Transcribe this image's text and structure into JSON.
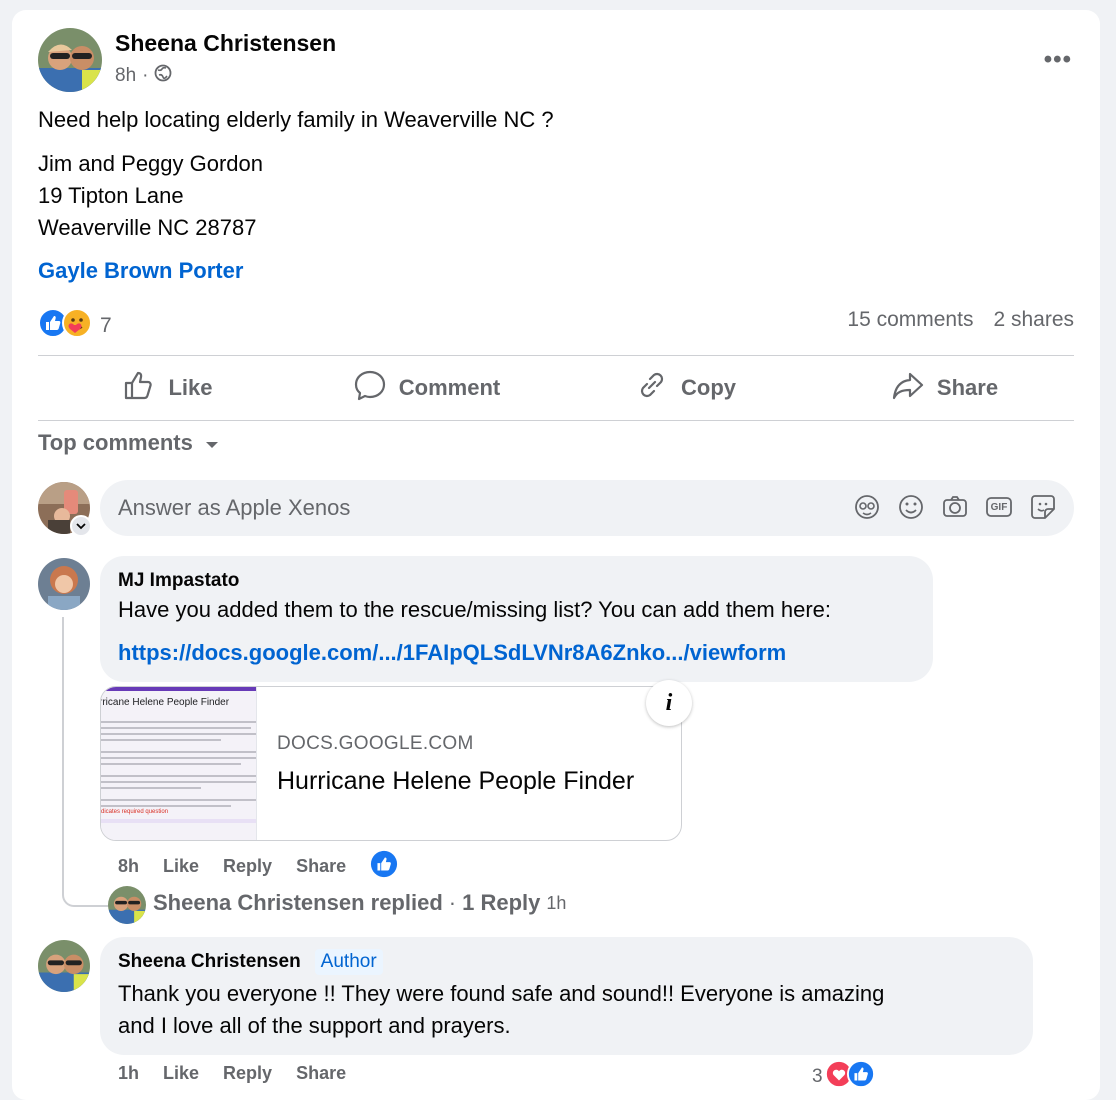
{
  "post": {
    "author": "Sheena Christensen",
    "time": "8h",
    "separator": "·",
    "text_line1": "Need help locating elderly family in Weaverville NC ?",
    "address_line1": "Jim and Peggy Gordon",
    "address_line2": "19 Tipton Lane",
    "address_line3": "Weaverville NC 28787",
    "mention": "Gayle Brown Porter",
    "reaction_count": "7",
    "comments_count": "15 comments",
    "shares_count": "2 shares",
    "more_label": "•••"
  },
  "actions": {
    "like": "Like",
    "comment": "Comment",
    "copy": "Copy",
    "share": "Share"
  },
  "comments_header": {
    "label": "Top comments"
  },
  "composer": {
    "placeholder": "Answer as Apple Xenos",
    "gif_label": "GIF"
  },
  "comments": [
    {
      "author": "MJ Impastato",
      "text": "Have you added them to the rescue/missing list? You can add them here:",
      "link": "https://docs.google.com/.../1FAIpQLSdLVNr8A6Znko.../viewform",
      "preview": {
        "domain": "DOCS.GOOGLE.COM",
        "title": "Hurricane Helene People Finder",
        "thumb_title": "rricane Helene People Finder",
        "thumb_required": "dicates required question",
        "info": "i"
      },
      "time": "8h",
      "like": "Like",
      "reply": "Reply",
      "share": "Share",
      "replied_by": "Sheena Christensen replied",
      "replied_sep": "·",
      "replies": "1 Reply",
      "replied_time": "1h"
    },
    {
      "author": "Sheena Christensen",
      "badge": "Author",
      "text_line1": "Thank you everyone !! They were found safe and sound!! Everyone is amazing",
      "text_line2": "and I love all of the support and prayers.",
      "time": "1h",
      "like": "Like",
      "reply": "Reply",
      "share": "Share",
      "reaction_count": "3"
    }
  ],
  "colors": {
    "link": "#0064d1",
    "secondary_text": "#65676b",
    "bubble": "#f0f2f5",
    "like_blue": "#1877f2",
    "love_red": "#f33e58"
  }
}
